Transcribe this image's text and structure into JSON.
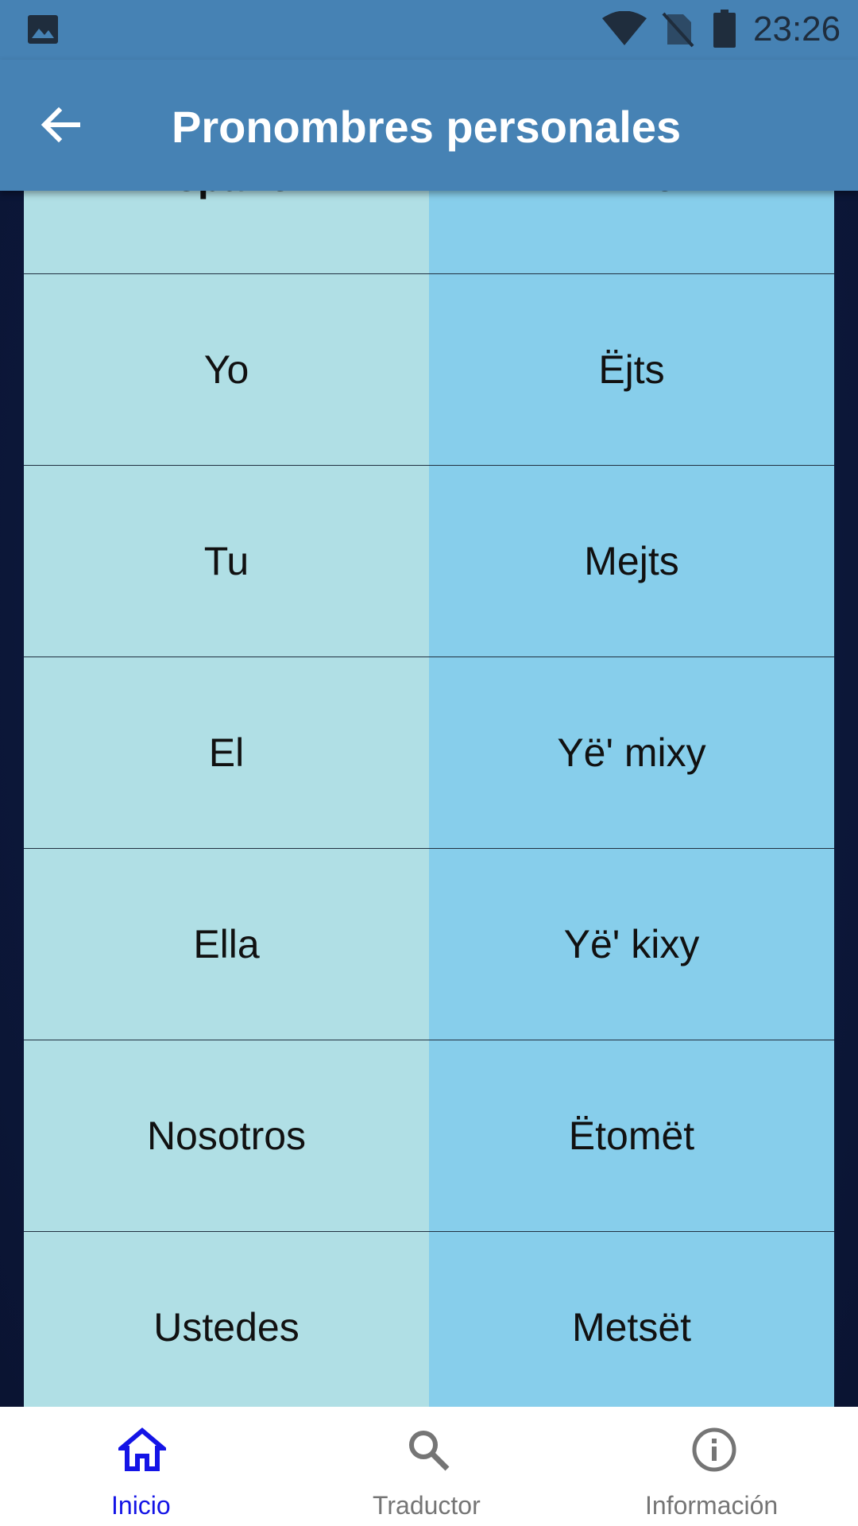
{
  "status_bar": {
    "time": "23:26",
    "icons": [
      "gallery-icon",
      "wifi-icon",
      "no-sim-icon",
      "battery-icon"
    ]
  },
  "app_bar": {
    "title": "Pronombres personales",
    "back_icon": "arrow-back-icon"
  },
  "table": {
    "headers": [
      "Español",
      "Mixe"
    ],
    "rows": [
      [
        "Yo",
        "Ëjts"
      ],
      [
        "Tu",
        "Mejts"
      ],
      [
        "El",
        "Yë' mixy"
      ],
      [
        "Ella",
        "Yë' kixy"
      ],
      [
        "Nosotros",
        "Ëtomët"
      ],
      [
        "Ustedes",
        "Metsët"
      ]
    ]
  },
  "bottom_nav": {
    "items": [
      {
        "label": "Inicio",
        "icon": "home-icon",
        "active": true
      },
      {
        "label": "Traductor",
        "icon": "search-icon",
        "active": false
      },
      {
        "label": "Información",
        "icon": "info-icon",
        "active": false
      }
    ]
  },
  "colors": {
    "bar": "#4682b4",
    "col_es": "#b0dfe5",
    "col_mx": "#87ceeb",
    "active_nav": "#1414e6",
    "inactive_nav": "#757575"
  }
}
